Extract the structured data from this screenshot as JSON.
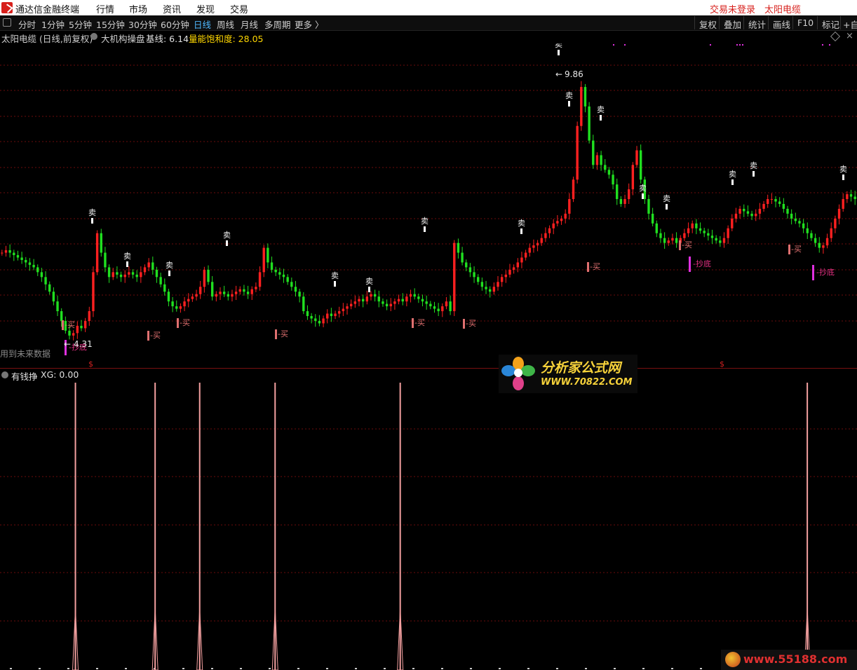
{
  "app": {
    "title": "通达信金融终端"
  },
  "menu": [
    "行情",
    "市场",
    "资讯",
    "发现",
    "交易"
  ],
  "status": {
    "login": "交易未登录",
    "stock": "太阳电缆"
  },
  "periods": [
    "分时",
    "1分钟",
    "5分钟",
    "15分钟",
    "30分钟",
    "60分钟",
    "日线",
    "周线",
    "月线",
    "多周期",
    "更多 〉"
  ],
  "active_period": "日线",
  "right_tools": [
    "复权",
    "叠加",
    "统计",
    "画线",
    "F10",
    "标记",
    "+自"
  ],
  "main_chart": {
    "title": "太阳电缆 (日线,前复权)",
    "indicator": "大机构操盘",
    "base_label": "基线: 6.14",
    "saturation_label": "量能饱和度: 28.05",
    "high_label": "9.86",
    "low_label": "4.31",
    "future_note": "用到未来数据",
    "sell_label": "卖",
    "buy_label": "买",
    "bottom_label": "抄底",
    "dollar": "$"
  },
  "sub_chart": {
    "title": "有钱挣",
    "value_label": "XG: 0.00"
  },
  "colors": {
    "up": "#ff2020",
    "down": "#20e020",
    "yellow": "#ffd700",
    "signal": "#e07070",
    "magenta": "#e030e0",
    "grid": "#6b0d0d",
    "spike": "#f4a0a0"
  },
  "watermarks": {
    "center_name": "分析家公式网",
    "center_url": "WWW.70822.COM",
    "corner_url": "www.55188.com"
  },
  "chart_data": {
    "type": "candlestick",
    "price_range": [
      4.31,
      9.86
    ],
    "closes": [
      6.2,
      6.25,
      6.2,
      6.15,
      6.1,
      6.05,
      6.0,
      5.95,
      5.9,
      5.8,
      5.7,
      5.55,
      5.4,
      5.2,
      5.0,
      4.8,
      4.6,
      4.5,
      4.55,
      4.7,
      4.65,
      4.8,
      5.0,
      5.8,
      6.6,
      6.2,
      5.9,
      5.7,
      5.8,
      5.75,
      5.7,
      5.75,
      5.8,
      5.75,
      5.7,
      5.8,
      5.9,
      6.0,
      5.85,
      5.7,
      5.55,
      5.4,
      5.2,
      5.1,
      5.05,
      5.1,
      5.2,
      5.25,
      5.3,
      5.35,
      5.5,
      5.85,
      5.6,
      5.3,
      5.35,
      5.4,
      5.35,
      5.3,
      5.35,
      5.4,
      5.45,
      5.4,
      5.35,
      5.45,
      5.5,
      5.8,
      6.3,
      6.0,
      5.85,
      5.8,
      5.75,
      5.7,
      5.6,
      5.5,
      5.4,
      5.3,
      5.0,
      4.9,
      4.85,
      4.8,
      4.75,
      4.85,
      4.95,
      4.9,
      4.95,
      5.0,
      5.05,
      5.1,
      5.15,
      5.2,
      5.25,
      5.2,
      5.3,
      5.35,
      5.3,
      5.2,
      5.15,
      5.1,
      5.15,
      5.2,
      5.25,
      5.2,
      5.3,
      5.35,
      5.3,
      5.25,
      5.2,
      5.15,
      5.1,
      5.05,
      5.0,
      5.1,
      5.2,
      5.0,
      6.4,
      6.2,
      6.0,
      5.9,
      5.8,
      5.7,
      5.6,
      5.5,
      5.45,
      5.4,
      5.5,
      5.6,
      5.7,
      5.75,
      5.85,
      5.9,
      6.0,
      6.1,
      6.2,
      6.3,
      6.35,
      6.4,
      6.5,
      6.6,
      6.7,
      6.8,
      6.85,
      6.9,
      7.0,
      7.3,
      7.7,
      8.8,
      9.6,
      9.2,
      8.5,
      8.0,
      8.2,
      8.0,
      7.9,
      7.8,
      7.6,
      7.3,
      7.2,
      7.3,
      7.5,
      8.0,
      8.3,
      7.7,
      7.3,
      7.0,
      6.8,
      6.6,
      6.5,
      6.4,
      6.45,
      6.5,
      6.4,
      6.5,
      6.6,
      6.7,
      6.8,
      6.7,
      6.65,
      6.6,
      6.55,
      6.5,
      6.45,
      6.4,
      6.5,
      6.7,
      6.9,
      7.0,
      7.1,
      7.05,
      7.0,
      6.95,
      7.0,
      7.1,
      7.2,
      7.3,
      7.3,
      7.25,
      7.2,
      7.1,
      7.0,
      6.9,
      6.85,
      6.8,
      6.7,
      6.6,
      6.5,
      6.4,
      6.3,
      6.35,
      6.5,
      6.7,
      6.9,
      7.1,
      7.3,
      7.4,
      7.35,
      7.3
    ]
  },
  "sub_chart_data": {
    "type": "spike",
    "signal_x_fraction": [
      0.088,
      0.181,
      0.233,
      0.321,
      0.467,
      0.942
    ]
  }
}
